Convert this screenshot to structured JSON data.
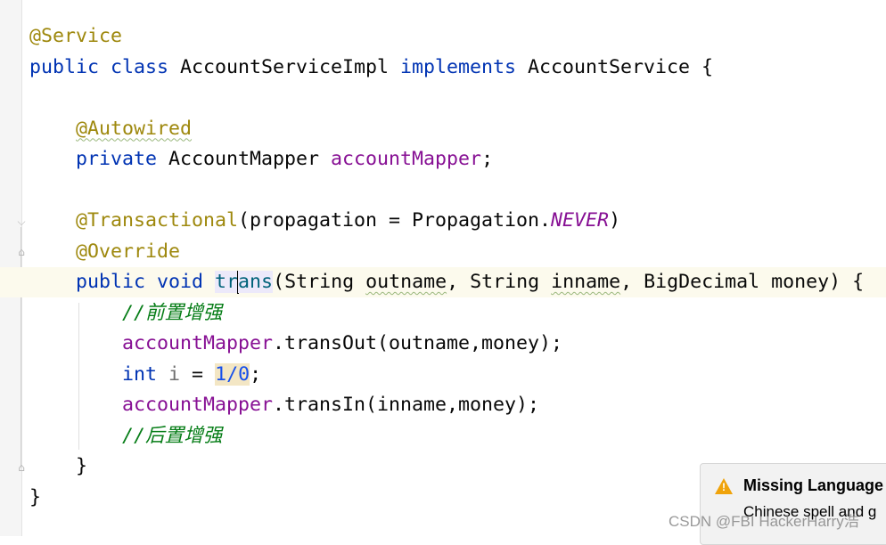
{
  "code": [
    [
      {
        "t": "@Service",
        "c": "ann"
      }
    ],
    [
      {
        "t": "public class ",
        "c": "kw"
      },
      {
        "t": "AccountServiceImpl ",
        "c": "pl"
      },
      {
        "t": "implements ",
        "c": "kw"
      },
      {
        "t": "AccountService {",
        "c": "pl"
      }
    ],
    [],
    [
      {
        "t": "    "
      },
      {
        "t": "@Autowired",
        "c": "ann warn"
      }
    ],
    [
      {
        "t": "    "
      },
      {
        "t": "private ",
        "c": "kw"
      },
      {
        "t": "AccountMapper ",
        "c": "pl"
      },
      {
        "t": "accountMapper",
        "c": "fld"
      },
      {
        "t": ";",
        "c": "pl"
      }
    ],
    [],
    [
      {
        "t": "    "
      },
      {
        "t": "@Transactional",
        "c": "ann"
      },
      {
        "t": "(propagation = Propagation.",
        "c": "pl"
      },
      {
        "t": "NEVER",
        "c": "it"
      },
      {
        "t": ")",
        "c": "pl"
      }
    ],
    [
      {
        "t": "    "
      },
      {
        "t": "@Override",
        "c": "ann"
      }
    ],
    [
      {
        "t": "    "
      },
      {
        "t": "public void ",
        "c": "kw"
      },
      {
        "t": "tr",
        "c": "mth hl"
      },
      {
        "t": "|",
        "c": "caret"
      },
      {
        "t": "ans",
        "c": "mth hl"
      },
      {
        "t": "(String ",
        "c": "pl"
      },
      {
        "t": "outname",
        "c": "pl warn"
      },
      {
        "t": ", String ",
        "c": "pl"
      },
      {
        "t": "inname",
        "c": "pl warn"
      },
      {
        "t": ", BigDecimal money) {",
        "c": "pl"
      }
    ],
    [
      {
        "t": "        "
      },
      {
        "t": "//前置增强",
        "c": "cm"
      }
    ],
    [
      {
        "t": "        "
      },
      {
        "t": "accountMapper",
        "c": "fld"
      },
      {
        "t": ".transOut(outname,money);",
        "c": "pl"
      }
    ],
    [
      {
        "t": "        "
      },
      {
        "t": "int ",
        "c": "kw"
      },
      {
        "t": "i ",
        "c": "lv"
      },
      {
        "t": "= ",
        "c": "pl"
      },
      {
        "t": "1/0",
        "c": "num hlnum"
      },
      {
        "t": ";",
        "c": "pl"
      }
    ],
    [
      {
        "t": "        "
      },
      {
        "t": "accountMapper",
        "c": "fld"
      },
      {
        "t": ".transIn(inname,money);",
        "c": "pl"
      }
    ],
    [
      {
        "t": "        "
      },
      {
        "t": "//后置增强",
        "c": "cm"
      }
    ],
    [
      {
        "t": "    "
      },
      {
        "t": "}",
        "c": "pl"
      }
    ],
    [
      {
        "t": "}",
        "c": "pl"
      }
    ]
  ],
  "popup": {
    "title": "Missing Language",
    "body": "Chinese spell and g",
    "icon": "warning-icon"
  },
  "watermark": "CSDN @FBI HackerHarry浩"
}
